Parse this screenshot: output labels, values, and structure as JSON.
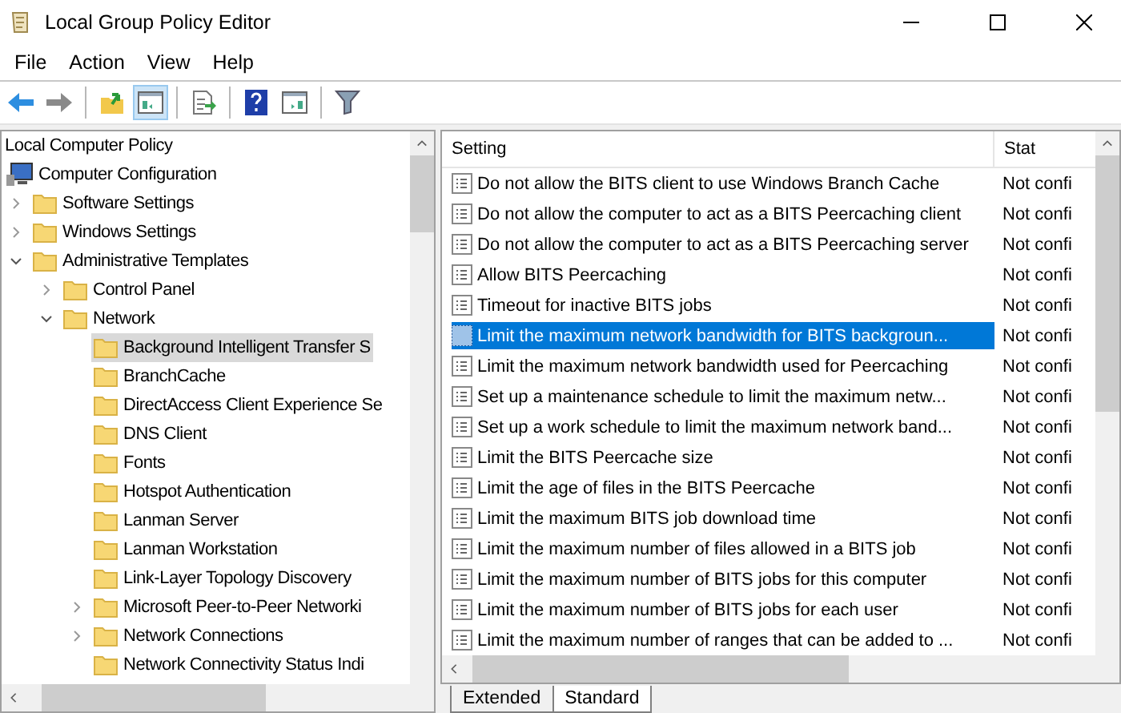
{
  "window": {
    "title": "Local Group Policy Editor"
  },
  "menu": [
    "File",
    "Action",
    "View",
    "Help"
  ],
  "toolbar": [
    {
      "kind": "back",
      "selected": false
    },
    {
      "kind": "forward",
      "selected": false
    },
    {
      "kind": "sep"
    },
    {
      "kind": "up",
      "selected": false
    },
    {
      "kind": "tree",
      "selected": true
    },
    {
      "kind": "sep"
    },
    {
      "kind": "export",
      "selected": false
    },
    {
      "kind": "sep"
    },
    {
      "kind": "help",
      "selected": false
    },
    {
      "kind": "pane",
      "selected": false
    },
    {
      "kind": "sep"
    },
    {
      "kind": "filter",
      "selected": false
    }
  ],
  "tree": [
    {
      "label": "Local Computer Policy",
      "selected": false,
      "children": [
        {
          "label": "Computer Configuration",
          "kind": "computer",
          "selected": false,
          "children": [
            {
              "label": "Software Settings",
              "kind": "folder",
              "selected": false,
              "expanded": false
            },
            {
              "label": "Windows Settings",
              "kind": "folder",
              "selected": false,
              "expanded": false
            },
            {
              "label": "Administrative Templates",
              "kind": "folder",
              "selected": false,
              "expanded": true,
              "children": [
                {
                  "label": "Control Panel",
                  "kind": "folder",
                  "selected": false,
                  "expanded": false
                },
                {
                  "label": "Network",
                  "kind": "folder",
                  "selected": false,
                  "expanded": true,
                  "children": [
                    {
                      "label": "Background Intelligent Transfer S",
                      "kind": "folder",
                      "selected": true
                    },
                    {
                      "label": "BranchCache",
                      "kind": "folder",
                      "selected": false
                    },
                    {
                      "label": "DirectAccess Client Experience Se",
                      "kind": "folder",
                      "selected": false
                    },
                    {
                      "label": "DNS Client",
                      "kind": "folder",
                      "selected": false
                    },
                    {
                      "label": "Fonts",
                      "kind": "folder",
                      "selected": false
                    },
                    {
                      "label": "Hotspot Authentication",
                      "kind": "folder",
                      "selected": false
                    },
                    {
                      "label": "Lanman Server",
                      "kind": "folder",
                      "selected": false
                    },
                    {
                      "label": "Lanman Workstation",
                      "kind": "folder",
                      "selected": false
                    },
                    {
                      "label": "Link-Layer Topology Discovery",
                      "kind": "folder",
                      "selected": false
                    },
                    {
                      "label": "Microsoft Peer-to-Peer Networki",
                      "kind": "folder",
                      "selected": false,
                      "expanded": false
                    },
                    {
                      "label": "Network Connections",
                      "kind": "folder",
                      "selected": false,
                      "expanded": false
                    },
                    {
                      "label": "Network Connectivity Status Indi",
                      "kind": "folder",
                      "selected": false
                    }
                  ]
                }
              ]
            }
          ]
        }
      ]
    }
  ],
  "table": {
    "columns": [
      "Setting",
      "Stat"
    ],
    "rows": [
      {
        "setting": "Do not allow the BITS client to use Windows Branch Cache",
        "state": "Not confi",
        "selected": false
      },
      {
        "setting": "Do not allow the computer to act as a BITS Peercaching client",
        "state": "Not confi",
        "selected": false
      },
      {
        "setting": "Do not allow the computer to act as a BITS Peercaching server",
        "state": "Not confi",
        "selected": false
      },
      {
        "setting": "Allow BITS Peercaching",
        "state": "Not confi",
        "selected": false
      },
      {
        "setting": "Timeout for inactive BITS jobs",
        "state": "Not confi",
        "selected": false
      },
      {
        "setting": "Limit the maximum network bandwidth for BITS backgroun...",
        "state": "Not confi",
        "selected": true
      },
      {
        "setting": "Limit the maximum network bandwidth used for Peercaching",
        "state": "Not confi",
        "selected": false
      },
      {
        "setting": "Set up a maintenance schedule to limit the maximum netw...",
        "state": "Not confi",
        "selected": false
      },
      {
        "setting": "Set up a work schedule to limit the maximum network band...",
        "state": "Not confi",
        "selected": false
      },
      {
        "setting": "Limit the BITS Peercache size",
        "state": "Not confi",
        "selected": false
      },
      {
        "setting": "Limit the age of files in the BITS Peercache",
        "state": "Not confi",
        "selected": false
      },
      {
        "setting": "Limit the maximum BITS job download time",
        "state": "Not confi",
        "selected": false
      },
      {
        "setting": "Limit the maximum number of files allowed in a BITS job",
        "state": "Not confi",
        "selected": false
      },
      {
        "setting": "Limit the maximum number of BITS jobs for this computer",
        "state": "Not confi",
        "selected": false
      },
      {
        "setting": "Limit the maximum number of BITS jobs for each user",
        "state": "Not confi",
        "selected": false
      },
      {
        "setting": "Limit the maximum number of ranges that can be added to ...",
        "state": "Not confi",
        "selected": false
      }
    ]
  },
  "tabs": [
    {
      "label": "Extended",
      "selected": false
    },
    {
      "label": "Standard",
      "selected": true
    }
  ]
}
